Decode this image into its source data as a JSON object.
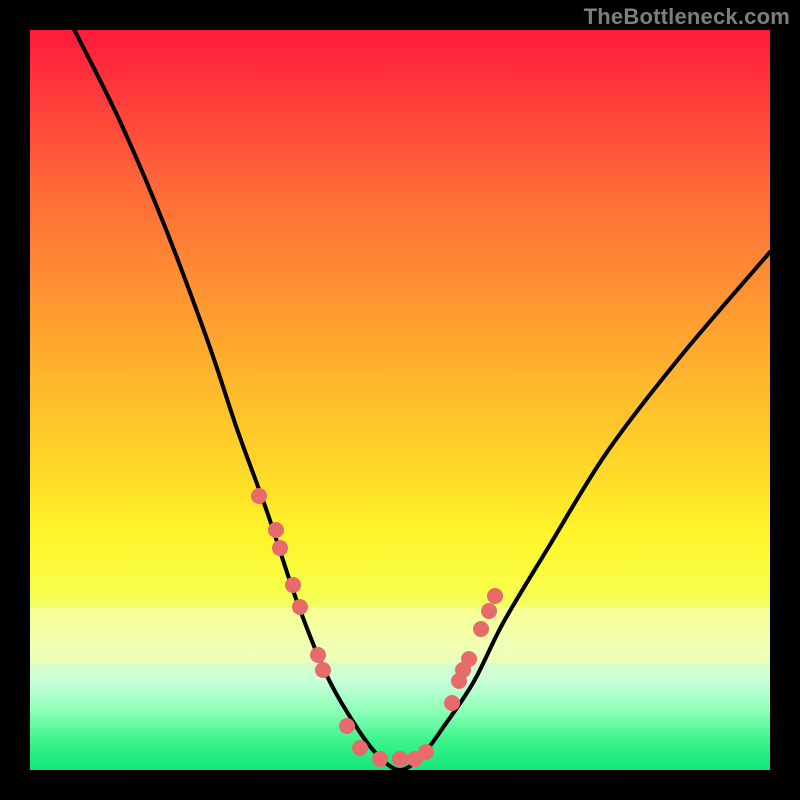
{
  "watermark": "TheBottleneck.com",
  "chart_data": {
    "type": "line",
    "title": "",
    "xlabel": "",
    "ylabel": "",
    "xlim": [
      0,
      100
    ],
    "ylim": [
      0,
      100
    ],
    "legend": false,
    "grid": false,
    "series": [
      {
        "name": "bottleneck-curve",
        "x": [
          6,
          12,
          18,
          24,
          28,
          32,
          36,
          40,
          44,
          47,
          50,
          53,
          56,
          60,
          64,
          70,
          78,
          88,
          100
        ],
        "y": [
          100,
          88,
          74,
          58,
          46,
          35,
          23,
          13,
          6,
          2,
          0,
          2,
          6,
          12,
          20,
          30,
          43,
          56,
          70
        ]
      }
    ],
    "markers": {
      "name": "sample-points",
      "x": [
        31.0,
        33.2,
        33.8,
        35.6,
        36.5,
        38.9,
        39.6,
        42.8,
        44.6,
        47.3,
        50.0,
        52.0,
        53.5,
        57.0,
        58.0,
        58.5,
        59.3,
        61.0,
        62.0,
        62.8
      ],
      "y": [
        37.0,
        32.5,
        30.0,
        25.0,
        22.0,
        15.5,
        13.5,
        6.0,
        3.0,
        1.5,
        1.5,
        1.5,
        2.5,
        9.0,
        12.0,
        13.5,
        15.0,
        19.0,
        21.5,
        23.5
      ]
    },
    "colors": {
      "curve": "#000000",
      "marker": "#e86b6b",
      "gradient_top": "#ff1a3c",
      "gradient_bottom": "#14e57a"
    }
  }
}
